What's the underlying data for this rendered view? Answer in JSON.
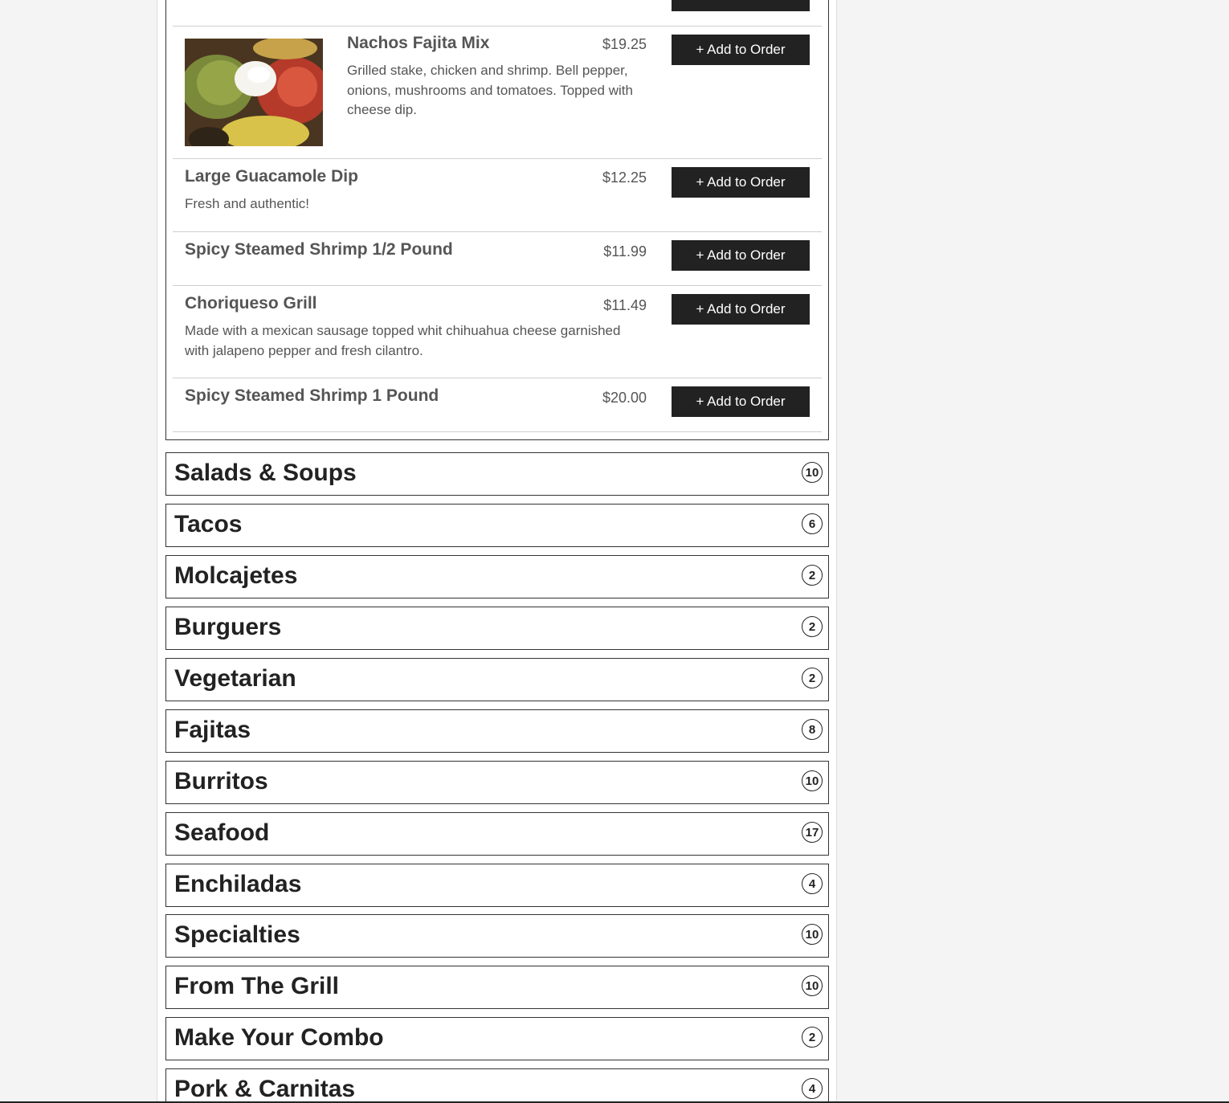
{
  "open_category": {
    "items": [
      {
        "name": "",
        "price": "",
        "description": "",
        "button": "+ Add to Order"
      },
      {
        "name": "Nachos Fajita Mix",
        "price": "$19.25",
        "description": "Grilled stake, chicken and shrimp. Bell pepper, onions, mushrooms and tomatoes. Topped with cheese dip.",
        "button": "+ Add to Order"
      },
      {
        "name": "Large Guacamole Dip",
        "price": "$12.25",
        "description": "Fresh and authentic!",
        "button": "+ Add to Order"
      },
      {
        "name": "Spicy Steamed Shrimp 1/2 Pound",
        "price": "$11.99",
        "description": "",
        "button": "+ Add to Order"
      },
      {
        "name": "Choriqueso Grill",
        "price": "$11.49",
        "description": "Made with a mexican sausage topped whit chihuahua cheese garnished with jalapeno pepper and fresh cilantro.",
        "button": "+ Add to Order"
      },
      {
        "name": "Spicy Steamed Shrimp 1 Pound",
        "price": "$20.00",
        "description": "",
        "button": "+ Add to Order"
      }
    ]
  },
  "categories": [
    {
      "title": "Salads & Soups",
      "count": "10"
    },
    {
      "title": "Tacos",
      "count": "6"
    },
    {
      "title": "Molcajetes",
      "count": "2"
    },
    {
      "title": "Burguers",
      "count": "2"
    },
    {
      "title": "Vegetarian",
      "count": "2"
    },
    {
      "title": "Fajitas",
      "count": "8"
    },
    {
      "title": "Burritos",
      "count": "10"
    },
    {
      "title": "Seafood",
      "count": "17"
    },
    {
      "title": "Enchiladas",
      "count": "4"
    },
    {
      "title": "Specialties",
      "count": "10"
    },
    {
      "title": "From The Grill",
      "count": "10"
    },
    {
      "title": "Make Your Combo",
      "count": "2"
    },
    {
      "title": "Pork & Carnitas",
      "count": "4"
    }
  ]
}
